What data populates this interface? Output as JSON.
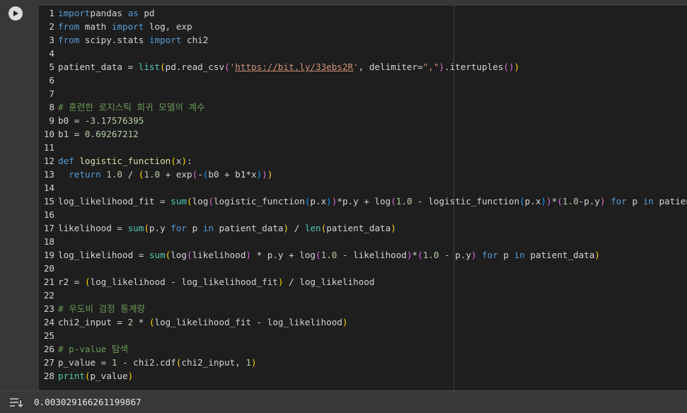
{
  "cell": {
    "run_label": "Run cell",
    "lines": [
      {
        "n": "1",
        "tokens": [
          [
            "kw",
            "import"
          ],
          [
            "",
            "pandas "
          ],
          [
            "kw",
            "as"
          ],
          [
            "",
            " pd"
          ]
        ]
      },
      {
        "n": "2",
        "tokens": [
          [
            "kw",
            "from"
          ],
          [
            "",
            " math "
          ],
          [
            "kw",
            "import"
          ],
          [
            "",
            " log, exp"
          ]
        ]
      },
      {
        "n": "3",
        "tokens": [
          [
            "kw",
            "from"
          ],
          [
            "",
            " scipy.stats "
          ],
          [
            "kw",
            "import"
          ],
          [
            "",
            " chi2"
          ]
        ]
      },
      {
        "n": "4",
        "tokens": []
      },
      {
        "n": "5",
        "tokens": [
          [
            "",
            "patient_data = "
          ],
          [
            "bi",
            "list"
          ],
          [
            "p1",
            "("
          ],
          [
            "",
            "pd.read_csv"
          ],
          [
            "p2",
            "("
          ],
          [
            "str",
            "'"
          ],
          [
            "url",
            "https://bit.ly/33ebs2R"
          ],
          [
            "str",
            "'"
          ],
          [
            "",
            ", delimiter="
          ],
          [
            "str",
            "\",\""
          ],
          [
            "p2",
            ")"
          ],
          [
            "",
            ".itertuples"
          ],
          [
            "p2",
            "()"
          ],
          [
            "p1",
            ")"
          ]
        ]
      },
      {
        "n": "6",
        "tokens": []
      },
      {
        "n": "7",
        "tokens": []
      },
      {
        "n": "8",
        "tokens": [
          [
            "cmt",
            "# 훈련한 로지스틱 회귀 모델의 계수"
          ]
        ]
      },
      {
        "n": "9",
        "tokens": [
          [
            "",
            "b0 = -"
          ],
          [
            "num",
            "3.17576395"
          ]
        ]
      },
      {
        "n": "10",
        "tokens": [
          [
            "",
            "b1 = "
          ],
          [
            "num",
            "0.69267212"
          ]
        ]
      },
      {
        "n": "11",
        "tokens": []
      },
      {
        "n": "12",
        "tokens": [
          [
            "kw",
            "def"
          ],
          [
            "",
            " "
          ],
          [
            "fn",
            "logistic_function"
          ],
          [
            "p1",
            "("
          ],
          [
            "",
            "x"
          ],
          [
            "p1",
            ")"
          ],
          [
            "",
            ":"
          ]
        ]
      },
      {
        "n": "13",
        "tokens": [
          [
            "",
            "  "
          ],
          [
            "kw",
            "return"
          ],
          [
            "",
            " "
          ],
          [
            "num",
            "1.0"
          ],
          [
            "",
            " / "
          ],
          [
            "p1",
            "("
          ],
          [
            "num",
            "1.0"
          ],
          [
            "",
            " + exp"
          ],
          [
            "p2",
            "("
          ],
          [
            "",
            "-"
          ],
          [
            "p3",
            "("
          ],
          [
            "",
            "b0 + b1*x"
          ],
          [
            "p3",
            ")"
          ],
          [
            "p2",
            ")"
          ],
          [
            "p1",
            ")"
          ]
        ]
      },
      {
        "n": "14",
        "tokens": []
      },
      {
        "n": "15",
        "tokens": [
          [
            "",
            "log_likelihood_fit = "
          ],
          [
            "bi",
            "sum"
          ],
          [
            "p1",
            "("
          ],
          [
            "",
            "log"
          ],
          [
            "p2",
            "("
          ],
          [
            "",
            "logistic_function"
          ],
          [
            "p3",
            "("
          ],
          [
            "",
            "p.x"
          ],
          [
            "p3",
            ")"
          ],
          [
            "p2",
            ")"
          ],
          [
            "",
            "*p.y + log"
          ],
          [
            "p2",
            "("
          ],
          [
            "num",
            "1.0"
          ],
          [
            "",
            " - logistic_function"
          ],
          [
            "p3",
            "("
          ],
          [
            "",
            "p.x"
          ],
          [
            "p3",
            ")"
          ],
          [
            "p2",
            ")"
          ],
          [
            "",
            "*"
          ],
          [
            "p2",
            "("
          ],
          [
            "num",
            "1.0"
          ],
          [
            "",
            "-p.y"
          ],
          [
            "p2",
            ")"
          ],
          [
            "",
            " "
          ],
          [
            "kw",
            "for"
          ],
          [
            "",
            " p "
          ],
          [
            "kw",
            "in"
          ],
          [
            "",
            " patient_data"
          ],
          [
            "p1",
            ")"
          ]
        ]
      },
      {
        "n": "16",
        "tokens": []
      },
      {
        "n": "17",
        "tokens": [
          [
            "",
            "likelihood = "
          ],
          [
            "bi",
            "sum"
          ],
          [
            "p1",
            "("
          ],
          [
            "",
            "p.y "
          ],
          [
            "kw",
            "for"
          ],
          [
            "",
            " p "
          ],
          [
            "kw",
            "in"
          ],
          [
            "",
            " patient_data"
          ],
          [
            "p1",
            ")"
          ],
          [
            "",
            " / "
          ],
          [
            "bi",
            "len"
          ],
          [
            "p1",
            "("
          ],
          [
            "",
            "patient_data"
          ],
          [
            "p1",
            ")"
          ]
        ]
      },
      {
        "n": "18",
        "tokens": []
      },
      {
        "n": "19",
        "tokens": [
          [
            "",
            "log_likelihood = "
          ],
          [
            "bi",
            "sum"
          ],
          [
            "p1",
            "("
          ],
          [
            "",
            "log"
          ],
          [
            "p2",
            "("
          ],
          [
            "",
            "likelihood"
          ],
          [
            "p2",
            ")"
          ],
          [
            "",
            " * p.y + log"
          ],
          [
            "p2",
            "("
          ],
          [
            "num",
            "1.0"
          ],
          [
            "",
            " - likelihood"
          ],
          [
            "p2",
            ")"
          ],
          [
            "",
            "*"
          ],
          [
            "p2",
            "("
          ],
          [
            "num",
            "1.0"
          ],
          [
            "",
            " - p.y"
          ],
          [
            "p2",
            ")"
          ],
          [
            "",
            " "
          ],
          [
            "kw",
            "for"
          ],
          [
            "",
            " p "
          ],
          [
            "kw",
            "in"
          ],
          [
            "",
            " patient_data"
          ],
          [
            "p1",
            ")"
          ]
        ]
      },
      {
        "n": "20",
        "tokens": []
      },
      {
        "n": "21",
        "tokens": [
          [
            "",
            "r2 = "
          ],
          [
            "p1",
            "("
          ],
          [
            "",
            "log_likelihood - log_likelihood_fit"
          ],
          [
            "p1",
            ")"
          ],
          [
            "",
            " / log_likelihood"
          ]
        ]
      },
      {
        "n": "22",
        "tokens": []
      },
      {
        "n": "23",
        "tokens": [
          [
            "cmt",
            "# 우도비 검정 통계량"
          ]
        ]
      },
      {
        "n": "24",
        "tokens": [
          [
            "",
            "chi2_input = "
          ],
          [
            "num",
            "2"
          ],
          [
            "",
            " * "
          ],
          [
            "p1",
            "("
          ],
          [
            "",
            "log_likelihood_fit - log_likelihood"
          ],
          [
            "p1",
            ")"
          ]
        ]
      },
      {
        "n": "25",
        "tokens": []
      },
      {
        "n": "26",
        "tokens": [
          [
            "cmt",
            "# p-value 탐색"
          ]
        ]
      },
      {
        "n": "27",
        "tokens": [
          [
            "",
            "p_value = "
          ],
          [
            "num",
            "1"
          ],
          [
            "",
            " - chi2.cdf"
          ],
          [
            "p1",
            "("
          ],
          [
            "",
            "chi2_input, "
          ],
          [
            "num",
            "1"
          ],
          [
            "p1",
            ")"
          ]
        ]
      },
      {
        "n": "28",
        "tokens": [
          [
            "bi",
            "print"
          ],
          [
            "p1",
            "("
          ],
          [
            "",
            "p_value"
          ],
          [
            "p1",
            ")"
          ]
        ]
      }
    ]
  },
  "output": {
    "icon": "output-toggle-icon",
    "text": "0.003029166261199867"
  }
}
